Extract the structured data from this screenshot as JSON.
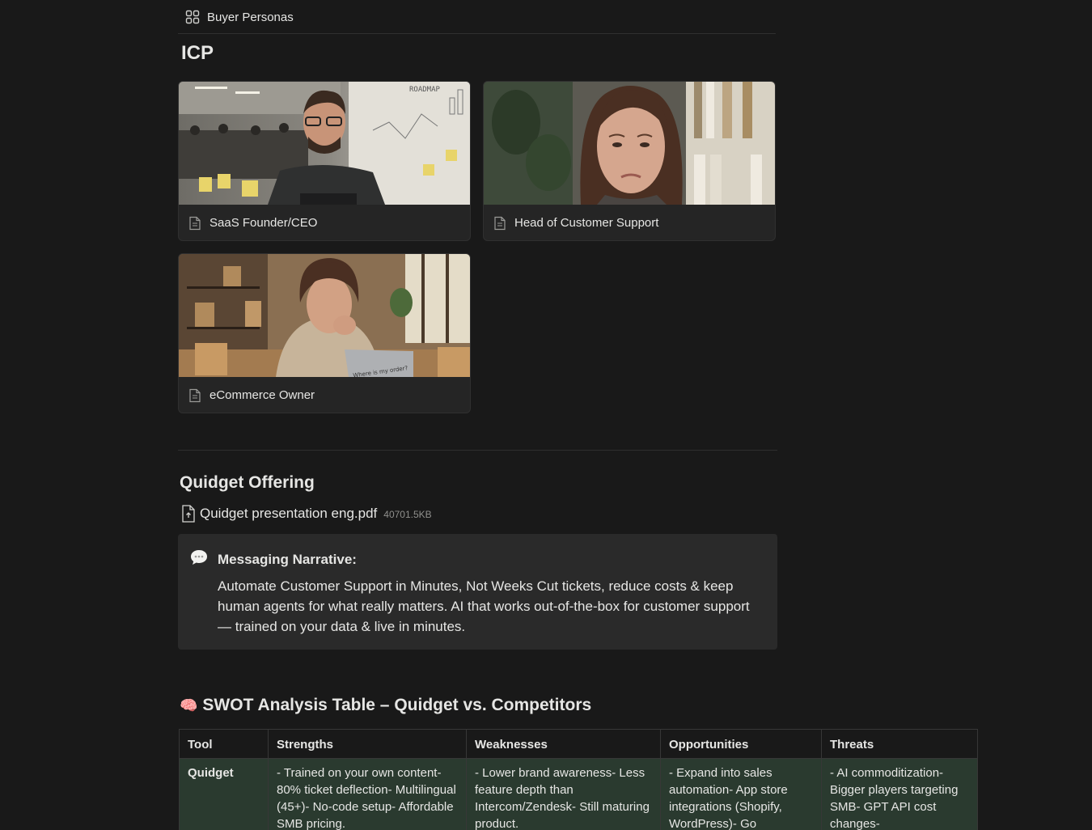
{
  "view": {
    "label": "Buyer Personas",
    "icon": "gallery-grid-icon"
  },
  "icp": {
    "title": "ICP",
    "cards": [
      {
        "title": "SaaS Founder/CEO",
        "icon": "page-icon"
      },
      {
        "title": "Head of Customer Support",
        "icon": "page-icon"
      },
      {
        "title": "eCommerce Owner",
        "icon": "page-icon"
      }
    ],
    "cover_texts": {
      "roadmap": "ROADMAP",
      "laptop_sticker": "Where is my order?"
    }
  },
  "offering": {
    "title": "Quidget Offering",
    "file": {
      "name": "Quidget presentation eng.pdf",
      "size": "40701.5KB",
      "icon": "pdf-file-icon"
    },
    "callout": {
      "icon": "speech-bubble-icon",
      "label": "Messaging Narrative:",
      "text": "Automate Customer Support in Minutes, Not Weeks Cut tickets, reduce costs & keep human agents for what really matters. AI that works out-of-the-box for customer support — trained on your data & live in minutes."
    }
  },
  "swot": {
    "emoji": "🧠",
    "title": "SWOT Analysis Table – Quidget vs. Competitors",
    "headers": [
      "Tool",
      "Strengths",
      "Weaknesses",
      "Opportunities",
      "Threats"
    ],
    "rows": [
      {
        "tool": "Quidget",
        "strengths": "- Trained on your own content- 80% ticket deflection- Multilingual (45+)- No-code setup- Affordable SMB pricing.",
        "weaknesses": "- Lower brand awareness- Less feature depth than Intercom/Zendesk- Still maturing product.",
        "opportunities": "- Expand into sales automation- App store integrations (Shopify, WordPress)- Go",
        "threats": "- AI commoditization- Bigger players targeting SMB- GPT API cost changes-"
      }
    ]
  },
  "colors": {
    "background": "#191919",
    "card": "#252525",
    "callout": "#2a2a2a",
    "table_row": "#2a3a2f",
    "text": "#e6e6e4",
    "muted": "#8f8f8c"
  }
}
